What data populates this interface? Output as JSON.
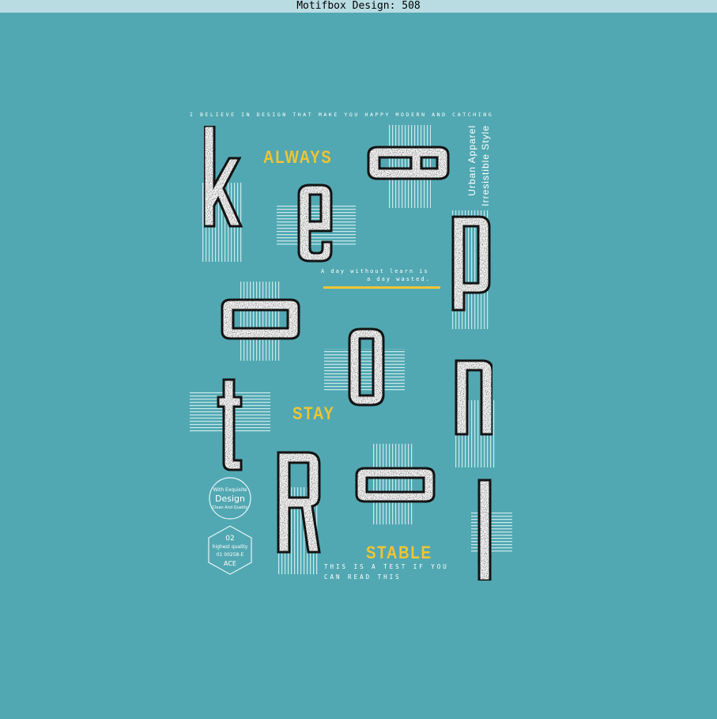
{
  "window": {
    "title": "Motifbox Design: 508"
  },
  "design": {
    "tagline_top": "I BELIEVE IN DESIGN THAT MAKE YOU HAPPY MODERN AND CATCHING",
    "always": "ALWAYS",
    "stay": "STAY",
    "stable": "STABLE",
    "vertical_1": "Urban Apparel",
    "vertical_2": "Irresistible Style",
    "quote_line1": "A day without learn is",
    "quote_line2": "a day wasted.",
    "bottom_line1": "THIS IS A TEST IF YOU",
    "bottom_line2": "CAN READ THIS",
    "letters": [
      "k",
      "e",
      "e",
      "p",
      "c",
      "o",
      "n",
      "t",
      "R",
      "o",
      "l"
    ],
    "badge_circle": {
      "line1": "With Exquisite",
      "line2": "Design",
      "line3": "Clean And Quality"
    },
    "badge_hex": {
      "line1": "02",
      "line2": "highest quality",
      "line3": "01 00258-E",
      "line4": "ACE"
    },
    "colors": {
      "background": "#52a8b2",
      "accent": "#f3c431",
      "letter_fill": "#ffffff",
      "outline": "#1b1b1b"
    }
  }
}
